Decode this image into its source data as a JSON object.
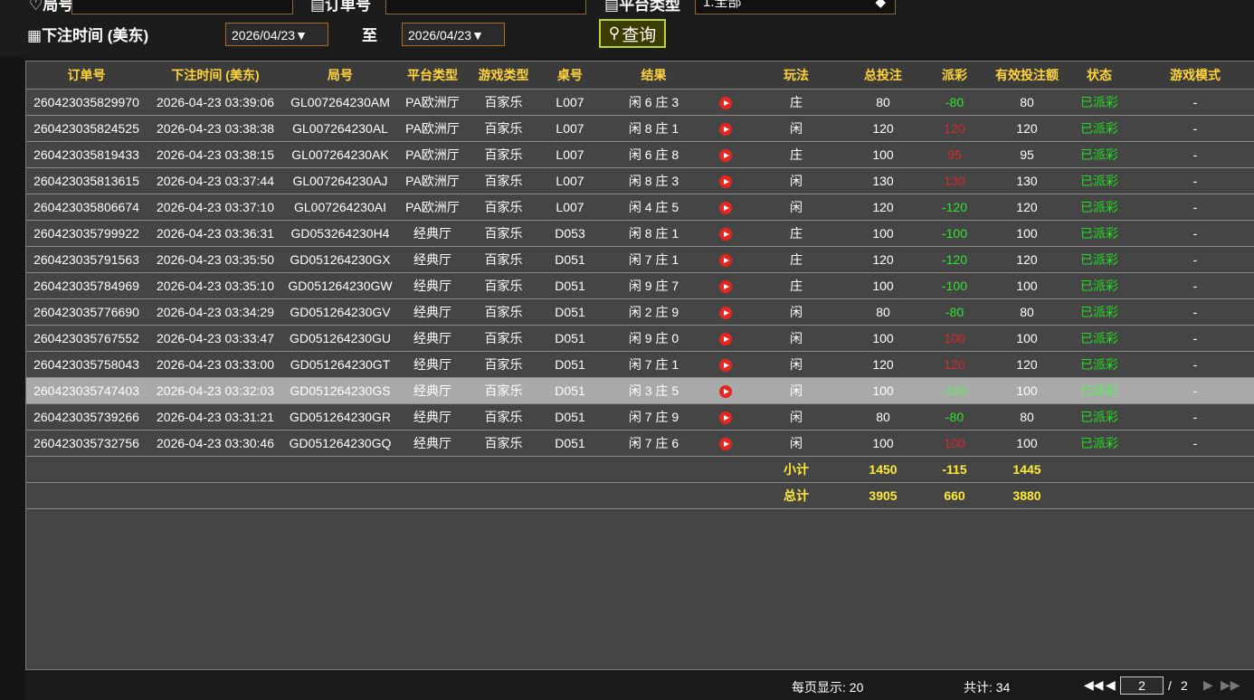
{
  "filters": {
    "round_label": "局号",
    "order_label": "订单号",
    "platform_label": "平台类型",
    "platform_value": "1.全部",
    "time_label": "下注时间 (美东)",
    "date_from": "2026/04/23▼",
    "to_label": "至",
    "date_to": "2026/04/23▼",
    "query_label": "查询"
  },
  "table": {
    "headers": [
      "订单号",
      "下注时间 (美东)",
      "局号",
      "平台类型",
      "游戏类型",
      "桌号",
      "结果",
      "",
      "玩法",
      "总投注",
      "派彩",
      "有效投注额",
      "状态",
      "游戏模式"
    ],
    "rows": [
      {
        "order": "260423035829970",
        "time": "2026-04-23 03:39:06",
        "round": "GL007264230AM",
        "platform": "PA欧洲厅",
        "game": "百家乐",
        "table": "L007",
        "result": "闲 6 庄 3",
        "play": "庄",
        "bet": "80",
        "payout": "-80",
        "payout_color": "green",
        "valid": "80",
        "status": "已派彩",
        "mode": "-"
      },
      {
        "order": "260423035824525",
        "time": "2026-04-23 03:38:38",
        "round": "GL007264230AL",
        "platform": "PA欧洲厅",
        "game": "百家乐",
        "table": "L007",
        "result": "闲 8 庄 1",
        "play": "闲",
        "bet": "120",
        "payout": "120",
        "payout_color": "red",
        "valid": "120",
        "status": "已派彩",
        "mode": "-"
      },
      {
        "order": "260423035819433",
        "time": "2026-04-23 03:38:15",
        "round": "GL007264230AK",
        "platform": "PA欧洲厅",
        "game": "百家乐",
        "table": "L007",
        "result": "闲 6 庄 8",
        "play": "庄",
        "bet": "100",
        "payout": "95",
        "payout_color": "red",
        "valid": "95",
        "status": "已派彩",
        "mode": "-"
      },
      {
        "order": "260423035813615",
        "time": "2026-04-23 03:37:44",
        "round": "GL007264230AJ",
        "platform": "PA欧洲厅",
        "game": "百家乐",
        "table": "L007",
        "result": "闲 8 庄 3",
        "play": "闲",
        "bet": "130",
        "payout": "130",
        "payout_color": "red",
        "valid": "130",
        "status": "已派彩",
        "mode": "-"
      },
      {
        "order": "260423035806674",
        "time": "2026-04-23 03:37:10",
        "round": "GL007264230AI",
        "platform": "PA欧洲厅",
        "game": "百家乐",
        "table": "L007",
        "result": "闲 4 庄 5",
        "play": "闲",
        "bet": "120",
        "payout": "-120",
        "payout_color": "green",
        "valid": "120",
        "status": "已派彩",
        "mode": "-"
      },
      {
        "order": "260423035799922",
        "time": "2026-04-23 03:36:31",
        "round": "GD053264230H4",
        "platform": "经典厅",
        "game": "百家乐",
        "table": "D053",
        "result": "闲 8 庄 1",
        "play": "庄",
        "bet": "100",
        "payout": "-100",
        "payout_color": "green",
        "valid": "100",
        "status": "已派彩",
        "mode": "-"
      },
      {
        "order": "260423035791563",
        "time": "2026-04-23 03:35:50",
        "round": "GD051264230GX",
        "platform": "经典厅",
        "game": "百家乐",
        "table": "D051",
        "result": "闲 7 庄 1",
        "play": "庄",
        "bet": "120",
        "payout": "-120",
        "payout_color": "green",
        "valid": "120",
        "status": "已派彩",
        "mode": "-"
      },
      {
        "order": "260423035784969",
        "time": "2026-04-23 03:35:10",
        "round": "GD051264230GW",
        "platform": "经典厅",
        "game": "百家乐",
        "table": "D051",
        "result": "闲 9 庄 7",
        "play": "庄",
        "bet": "100",
        "payout": "-100",
        "payout_color": "green",
        "valid": "100",
        "status": "已派彩",
        "mode": "-"
      },
      {
        "order": "260423035776690",
        "time": "2026-04-23 03:34:29",
        "round": "GD051264230GV",
        "platform": "经典厅",
        "game": "百家乐",
        "table": "D051",
        "result": "闲 2 庄 9",
        "play": "闲",
        "bet": "80",
        "payout": "-80",
        "payout_color": "green",
        "valid": "80",
        "status": "已派彩",
        "mode": "-"
      },
      {
        "order": "260423035767552",
        "time": "2026-04-23 03:33:47",
        "round": "GD051264230GU",
        "platform": "经典厅",
        "game": "百家乐",
        "table": "D051",
        "result": "闲 9 庄 0",
        "play": "闲",
        "bet": "100",
        "payout": "100",
        "payout_color": "red",
        "valid": "100",
        "status": "已派彩",
        "mode": "-"
      },
      {
        "order": "260423035758043",
        "time": "2026-04-23 03:33:00",
        "round": "GD051264230GT",
        "platform": "经典厅",
        "game": "百家乐",
        "table": "D051",
        "result": "闲 7 庄 1",
        "play": "闲",
        "bet": "120",
        "payout": "120",
        "payout_color": "red",
        "valid": "120",
        "status": "已派彩",
        "mode": "-"
      },
      {
        "order": "260423035747403",
        "time": "2026-04-23 03:32:03",
        "round": "GD051264230GS",
        "platform": "经典厅",
        "game": "百家乐",
        "table": "D051",
        "result": "闲 3 庄 5",
        "play": "闲",
        "bet": "100",
        "payout": "-100",
        "payout_color": "green",
        "valid": "100",
        "status": "已派彩",
        "mode": "-",
        "selected": true
      },
      {
        "order": "260423035739266",
        "time": "2026-04-23 03:31:21",
        "round": "GD051264230GR",
        "platform": "经典厅",
        "game": "百家乐",
        "table": "D051",
        "result": "闲 7 庄 9",
        "play": "闲",
        "bet": "80",
        "payout": "-80",
        "payout_color": "green",
        "valid": "80",
        "status": "已派彩",
        "mode": "-"
      },
      {
        "order": "260423035732756",
        "time": "2026-04-23 03:30:46",
        "round": "GD051264230GQ",
        "platform": "经典厅",
        "game": "百家乐",
        "table": "D051",
        "result": "闲 7 庄 6",
        "play": "闲",
        "bet": "100",
        "payout": "100",
        "payout_color": "red",
        "valid": "100",
        "status": "已派彩",
        "mode": "-"
      }
    ],
    "subtotal": {
      "label": "小计",
      "bet": "1450",
      "payout": "-115",
      "valid": "1445"
    },
    "total": {
      "label": "总计",
      "bet": "3905",
      "payout": "660",
      "valid": "3880"
    }
  },
  "pagination": {
    "per_page": "每页显示: 20",
    "total": "共计: 34",
    "current_page": "2",
    "separator": "/",
    "total_pages": "2"
  },
  "colors": {
    "header_text": "#ffd33a",
    "payout_loss": "#2ee52e",
    "payout_win": "#d42a2a",
    "status": "#22dd22",
    "totals": "#ffea3a",
    "play_icon": "#e8261f"
  }
}
